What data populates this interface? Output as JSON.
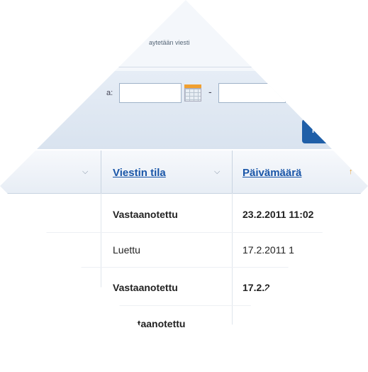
{
  "info": {
    "text": "aytetään viesti"
  },
  "filter": {
    "date_label": "a:",
    "separator": "-",
    "button_label": "Ha"
  },
  "table": {
    "headers": [
      {
        "label": "Viestin tila",
        "sort": "chevrons"
      },
      {
        "label": "Päivämäärä",
        "sort": "arrow"
      }
    ],
    "rows": [
      {
        "status": "Vastaanotettu",
        "status_bold": true,
        "date": "23.2.2011 11:02",
        "date_bold": true
      },
      {
        "status": "Luettu",
        "status_bold": false,
        "date": "17.2.2011 1",
        "date_bold": false
      },
      {
        "status": "Vastaanotettu",
        "status_bold": true,
        "date": "17.2.2",
        "date_bold": true
      },
      {
        "status": "staanotettu",
        "status_bold": true,
        "date": "",
        "date_bold": true
      }
    ]
  },
  "colors": {
    "link": "#1a56a8",
    "button": "#1f5fa8",
    "calendar_accent": "#f0a030"
  }
}
